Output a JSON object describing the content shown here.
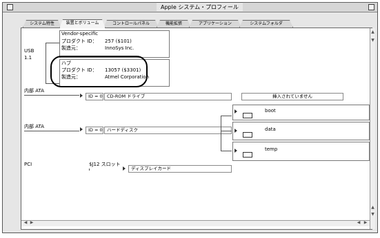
{
  "window": {
    "title": "Apple システム・プロフィール"
  },
  "tabs": [
    {
      "label": "システム特性",
      "active": false
    },
    {
      "label": "装置とボリューム",
      "active": true
    },
    {
      "label": "コントロールパネル",
      "active": false
    },
    {
      "label": "機能拡張",
      "active": false
    },
    {
      "label": "アプリケーション",
      "active": false
    },
    {
      "label": "システムフォルダ",
      "active": false
    }
  ],
  "usb": {
    "bus_label": "USB",
    "bus_version": "1.1",
    "device1": {
      "name": "Vendor-specific",
      "product_label": "プロダクト ID：",
      "product_id": "257 ($101)",
      "maker_label": "製造元：",
      "maker": "InnoSys Inc."
    },
    "device2": {
      "name": "ハブ",
      "product_label": "プロダクト ID：",
      "product_id": "13057 ($3301)",
      "maker_label": "製造元：",
      "maker": "Atmel Corporation"
    }
  },
  "ata1": {
    "bus_label": "内部 ATA",
    "id_label": "ID = 0",
    "device": "CD-ROM ドライブ",
    "status": "挿入されていません"
  },
  "ata2": {
    "bus_label": "内部 ATA",
    "id_label": "ID = 0",
    "device": "ハードディスク",
    "volumes": [
      "boot",
      "data",
      "temp"
    ]
  },
  "pci": {
    "bus_label": "PCI",
    "slot_label": "$J12 スロット",
    "device": "ディスプレイカード"
  }
}
